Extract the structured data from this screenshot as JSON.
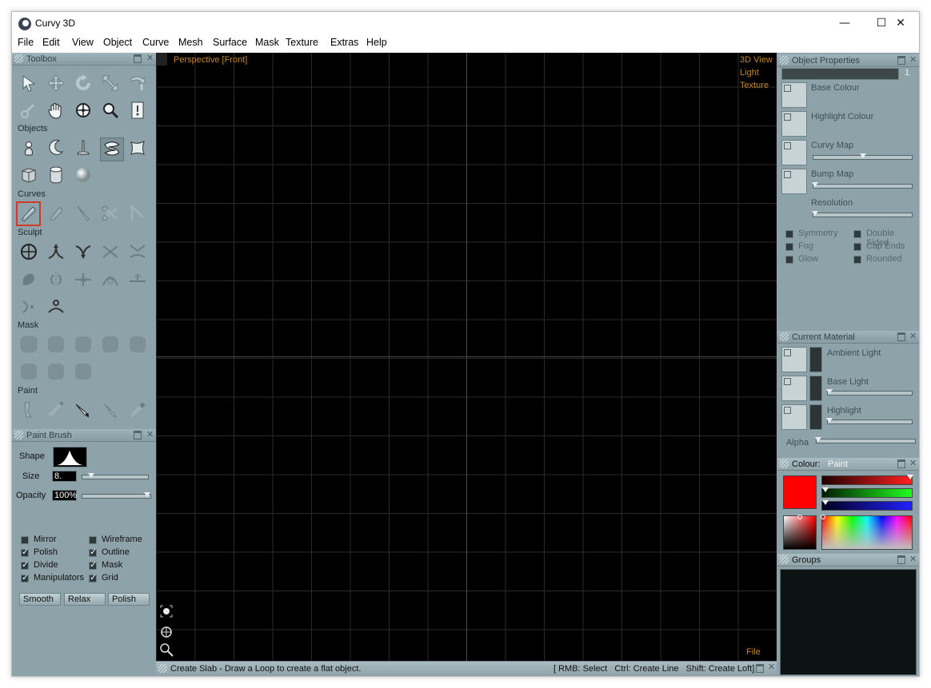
{
  "window": {
    "title": "Curvy 3D",
    "minimize": "—",
    "maximize": "☐",
    "close": "✕"
  },
  "menu": [
    "File",
    "Edit",
    "View",
    "Object",
    "Curve",
    "Mesh",
    "Surface",
    "Mask",
    "Texture",
    "Extras",
    "Help"
  ],
  "toolbox": {
    "title": "Toolbox",
    "sections": {
      "objects": "Objects",
      "curves": "Curves",
      "sculpt": "Sculpt",
      "mask": "Mask",
      "paint": "Paint"
    }
  },
  "brush": {
    "title": "Paint Brush",
    "shape_label": "Shape",
    "size_label": "Size",
    "size_value": "8.",
    "size_level": 0.1,
    "opacity_label": "Opacity",
    "opacity_value": "100%",
    "opacity_level": 1.0,
    "options": [
      {
        "label": "Mirror",
        "checked": false
      },
      {
        "label": "Wireframe",
        "checked": false
      },
      {
        "label": "Polish",
        "checked": true
      },
      {
        "label": "Outline",
        "checked": true
      },
      {
        "label": "Divide",
        "checked": true
      },
      {
        "label": "Mask",
        "checked": true
      },
      {
        "label": "Manipulators",
        "checked": true
      },
      {
        "label": "Grid",
        "checked": true
      }
    ],
    "buttons": [
      "Smooth",
      "Relax",
      "Polish"
    ]
  },
  "viewport": {
    "label": "Perspective [Front]",
    "view_menu": [
      "3D View",
      "Light",
      "Texture"
    ],
    "file_label": "File"
  },
  "status": {
    "message": "Create Slab - Draw a Loop to create a flat object.",
    "hints": "[ RMB: Select   Ctrl: Create Line   Shift: Create Loft]"
  },
  "object_properties": {
    "title": "Object Properties",
    "name_index": "1",
    "maps": [
      "Base Colour",
      "Highlight Colour",
      "Curvy Map",
      "Bump Map"
    ],
    "resolution_label": "Resolution",
    "options": [
      "Symmetry",
      "Double Sided",
      "Fog",
      "Cap Ends",
      "Glow",
      "Rounded"
    ]
  },
  "material": {
    "title": "Current Material",
    "items": [
      "Ambient Light",
      "Base Light",
      "Highlight"
    ],
    "alpha_label": "Alpha"
  },
  "colour": {
    "title": "Colour:",
    "mode": "Paint",
    "current": "#ff0000",
    "red": 1.0,
    "green": 0.0,
    "blue": 0.0
  },
  "groups": {
    "title": "Groups"
  },
  "colors": {
    "panel": "#8ea2a9",
    "viewport": "#000000",
    "accent_label": "#c3862f",
    "selection": "#d23a2a"
  }
}
